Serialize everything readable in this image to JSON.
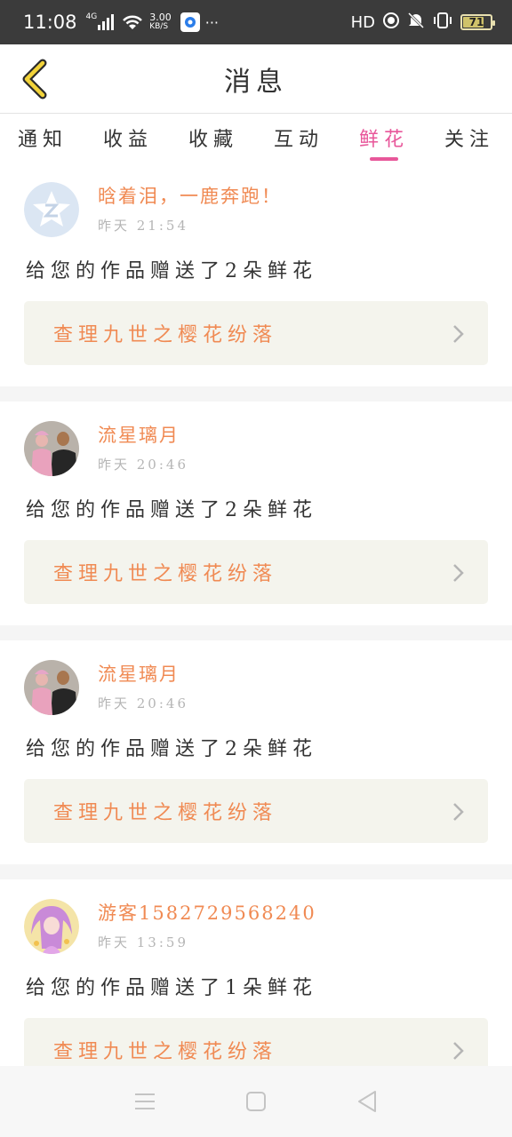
{
  "status_bar": {
    "time": "11:08",
    "network": "4G",
    "speed": "3.00",
    "speed_unit": "KB/S",
    "more": "···",
    "hd": "HD",
    "battery": "71"
  },
  "header": {
    "title": "消息"
  },
  "tabs": [
    {
      "label": "通知"
    },
    {
      "label": "收益"
    },
    {
      "label": "收藏"
    },
    {
      "label": "互动"
    },
    {
      "label": "鲜花",
      "active": true
    },
    {
      "label": "关注"
    }
  ],
  "messages": [
    {
      "username": "晗着泪，一鹿奔跑！",
      "time": "昨天 21:54",
      "text": "给您的作品赠送了2朵鲜花",
      "link": "查理九世之樱花纷落",
      "avatar": "qq-avatar-icon"
    },
    {
      "username": "流星璃月",
      "time": "昨天 20:46",
      "text": "给您的作品赠送了2朵鲜花",
      "link": "查理九世之樱花纷落",
      "avatar": "photo-avatar"
    },
    {
      "username": "流星璃月",
      "time": "昨天 20:46",
      "text": "给您的作品赠送了2朵鲜花",
      "link": "查理九世之樱花纷落",
      "avatar": "photo-avatar"
    },
    {
      "username": "游客1582729568240",
      "time": "昨天 13:59",
      "text": "给您的作品赠送了1朵鲜花",
      "link": "查理九世之樱花纷落",
      "avatar": "anime-avatar"
    }
  ],
  "colors": {
    "accent": "#e8579a",
    "username": "#f08a53",
    "link_bg": "#f4f4ed",
    "back_arrow": "#f2d33a"
  }
}
